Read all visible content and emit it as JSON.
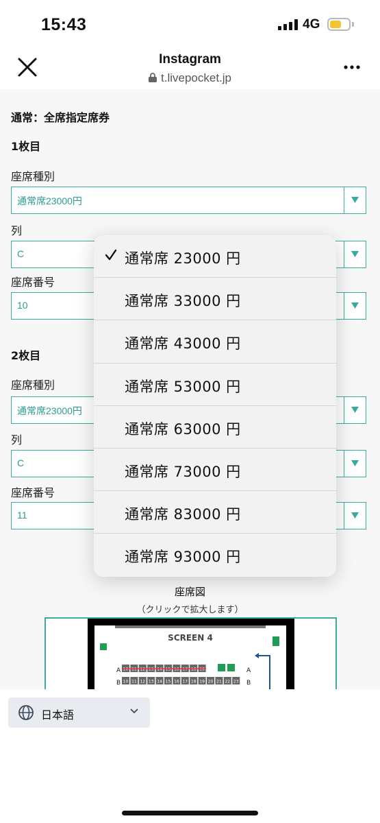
{
  "status_bar": {
    "time": "15:43",
    "network": "4G"
  },
  "browser": {
    "title": "Instagram",
    "url": "t.livepocket.jp"
  },
  "form": {
    "ticket_type": "通常：全席指定席券",
    "tickets": [
      {
        "heading": "1枚目",
        "seat_type_label": "座席種別",
        "seat_type_value": "通常席23000円",
        "row_label": "列",
        "row_value": "C",
        "seat_no_label": "座席番号",
        "seat_no_value": "10"
      },
      {
        "heading": "2枚目",
        "seat_type_label": "座席種別",
        "seat_type_value": "通常席23000円",
        "row_label": "列",
        "row_value": "C",
        "seat_no_label": "座席番号",
        "seat_no_value": "11"
      }
    ]
  },
  "seat_map": {
    "caption": "座席図",
    "subcaption": "（クリックで拡大します）",
    "screen_label": "SCREEN 4",
    "row_a": "A",
    "row_b": "B",
    "seat_numbers": [
      "10",
      "11",
      "12",
      "13",
      "14",
      "15",
      "16",
      "17",
      "18",
      "19",
      "20",
      "21",
      "22",
      "23"
    ]
  },
  "picker": {
    "selected_index": 0,
    "options": [
      "通常席 23000 円",
      "通常席 33000 円",
      "通常席 43000 円",
      "通常席 53000 円",
      "通常席 63000 円",
      "通常席 73000 円",
      "通常席 83000 円",
      "通常席 93000 円"
    ]
  },
  "footer": {
    "language": "日本語"
  },
  "colors": {
    "accent": "#3aaaa0",
    "value_text": "#2a9d8f"
  }
}
